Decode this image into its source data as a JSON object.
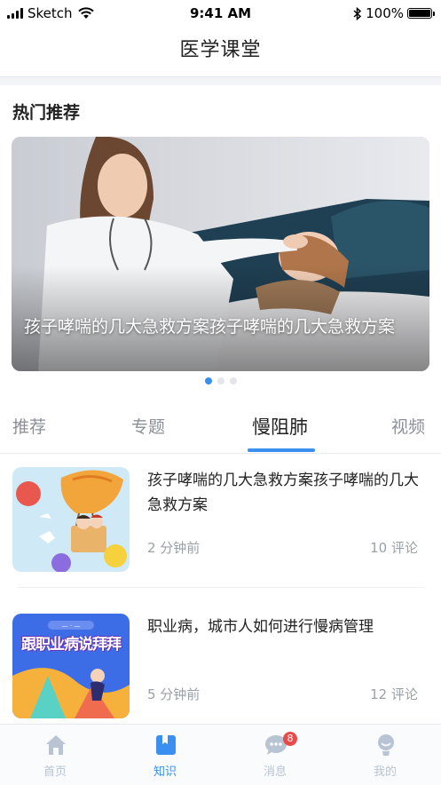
{
  "status_bar": {
    "carrier": "Sketch",
    "time": "9:41 AM",
    "battery": "100%",
    "battery_level": 1.0
  },
  "nav": {
    "title": "医学课堂"
  },
  "hot": {
    "section_title": "热门推荐",
    "banner_caption": "孩子哮喘的几大急救方案孩子哮喘的几大急救方案",
    "page_count": 3,
    "active_page": 0
  },
  "tabs": [
    {
      "label": "推荐",
      "active": false
    },
    {
      "label": "专题",
      "active": false
    },
    {
      "label": "慢阻肺",
      "active": true
    },
    {
      "label": "视频",
      "active": false
    }
  ],
  "articles": [
    {
      "title": "孩子哮喘的几大急救方案孩子哮喘的几大急救方案",
      "time": "2 分钟前",
      "comments": "10 评论",
      "thumb_icon": "hot-air-balloon-kids-illustration"
    },
    {
      "title": "职业病，城市人如何进行慢病管理",
      "time": "5 分钟前",
      "comments": "12 评论",
      "thumb_icon": "occupational-disease-poster-illustration",
      "thumb_text": "跟职业病说拜拜"
    }
  ],
  "tab_bar": [
    {
      "label": "首页",
      "icon": "home-icon",
      "active": false
    },
    {
      "label": "知识",
      "icon": "book-icon",
      "active": true
    },
    {
      "label": "消息",
      "icon": "chat-icon",
      "active": false,
      "badge": "8"
    },
    {
      "label": "我的",
      "icon": "profile-icon",
      "active": false
    }
  ],
  "colors": {
    "accent": "#3a8ff0",
    "inactive_tab": "#b8c4d4",
    "badge": "#e94a4a"
  }
}
